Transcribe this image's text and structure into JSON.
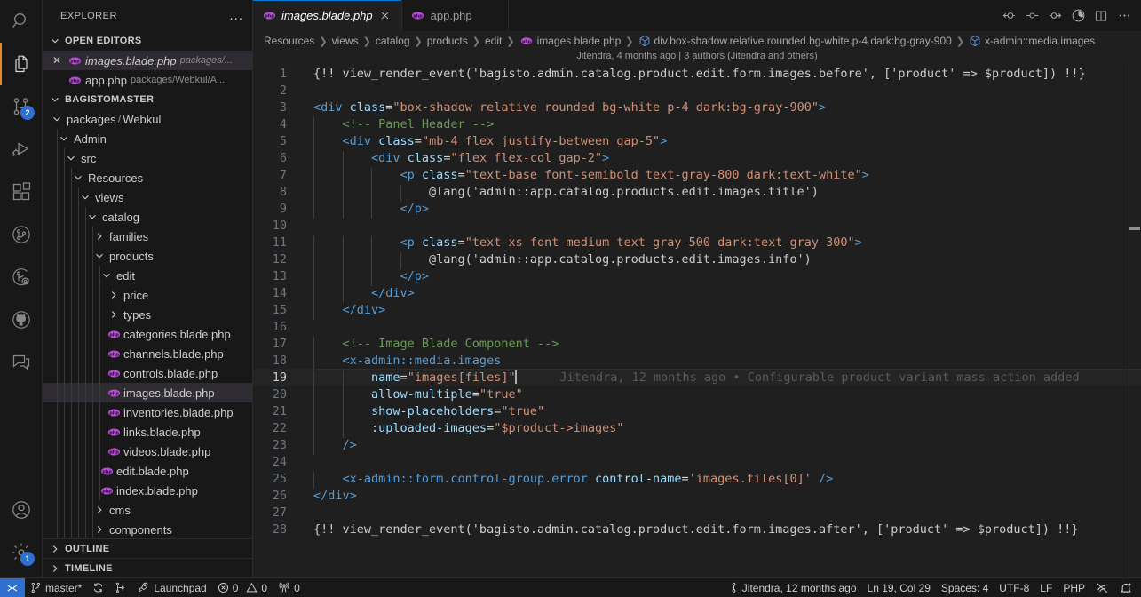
{
  "activity_bar": {
    "top_items": [
      {
        "name": "search-icon",
        "tooltip": "Search",
        "active": false,
        "badge": null
      },
      {
        "name": "explorer-icon",
        "tooltip": "Explorer",
        "active": true,
        "badge": null
      },
      {
        "name": "source-control-icon",
        "tooltip": "Source Control",
        "active": false,
        "badge": "2"
      },
      {
        "name": "run-and-debug-icon",
        "tooltip": "Run and Debug",
        "active": false,
        "badge": null
      },
      {
        "name": "extensions-icon",
        "tooltip": "Extensions",
        "active": false,
        "badge": null
      },
      {
        "name": "git-graph-icon",
        "tooltip": "Git Graph",
        "active": false,
        "badge": null
      },
      {
        "name": "git-lens-icon",
        "tooltip": "GitLens",
        "active": false,
        "badge": null
      },
      {
        "name": "github-icon",
        "tooltip": "GitHub",
        "active": false,
        "badge": null
      },
      {
        "name": "comments-icon",
        "tooltip": "Comments",
        "active": false,
        "badge": null
      }
    ],
    "bottom_items": [
      {
        "name": "account-icon",
        "tooltip": "Accounts",
        "badge": null
      },
      {
        "name": "settings-gear-icon",
        "tooltip": "Manage",
        "badge": "1"
      }
    ]
  },
  "sidebar": {
    "title": "EXPLORER",
    "more_actions_label": "...",
    "open_editors": {
      "label": "OPEN EDITORS",
      "expanded": true,
      "items": [
        {
          "name": "images.blade.php",
          "description": "packages/...",
          "selected": true,
          "dirty": false,
          "close_glyph": "✕",
          "italic": true
        },
        {
          "name": "app.php",
          "description": "packages/Webkul/A...",
          "selected": false,
          "dirty": false,
          "close_glyph": "✕",
          "italic": false
        }
      ]
    },
    "workspace": {
      "label": "BAGISTOMASTER",
      "expanded": true,
      "tree": [
        {
          "label": "packages",
          "label2": "Webkul",
          "kind": "folder",
          "depth": 1,
          "expanded": true,
          "selected": false
        },
        {
          "label": "Admin",
          "kind": "folder",
          "depth": 2,
          "expanded": true,
          "selected": false
        },
        {
          "label": "src",
          "kind": "folder",
          "depth": 3,
          "expanded": true,
          "selected": false
        },
        {
          "label": "Resources",
          "kind": "folder",
          "depth": 4,
          "expanded": true,
          "selected": false
        },
        {
          "label": "views",
          "kind": "folder",
          "depth": 5,
          "expanded": true,
          "selected": false
        },
        {
          "label": "catalog",
          "kind": "folder",
          "depth": 6,
          "expanded": true,
          "selected": false
        },
        {
          "label": "families",
          "kind": "folder",
          "depth": 7,
          "expanded": false,
          "selected": false
        },
        {
          "label": "products",
          "kind": "folder",
          "depth": 7,
          "expanded": true,
          "selected": false
        },
        {
          "label": "edit",
          "kind": "folder",
          "depth": 8,
          "expanded": true,
          "selected": false
        },
        {
          "label": "price",
          "kind": "folder",
          "depth": 9,
          "expanded": false,
          "selected": false
        },
        {
          "label": "types",
          "kind": "folder",
          "depth": 9,
          "expanded": false,
          "selected": false
        },
        {
          "label": "categories.blade.php",
          "kind": "php",
          "depth": 9,
          "expanded": false,
          "selected": false
        },
        {
          "label": "channels.blade.php",
          "kind": "php",
          "depth": 9,
          "expanded": false,
          "selected": false
        },
        {
          "label": "controls.blade.php",
          "kind": "php",
          "depth": 9,
          "expanded": false,
          "selected": false
        },
        {
          "label": "images.blade.php",
          "kind": "php",
          "depth": 9,
          "expanded": false,
          "selected": true
        },
        {
          "label": "inventories.blade.php",
          "kind": "php",
          "depth": 9,
          "expanded": false,
          "selected": false
        },
        {
          "label": "links.blade.php",
          "kind": "php",
          "depth": 9,
          "expanded": false,
          "selected": false
        },
        {
          "label": "videos.blade.php",
          "kind": "php",
          "depth": 9,
          "expanded": false,
          "selected": false
        },
        {
          "label": "edit.blade.php",
          "kind": "php",
          "depth": 8,
          "expanded": false,
          "selected": false
        },
        {
          "label": "index.blade.php",
          "kind": "php",
          "depth": 8,
          "expanded": false,
          "selected": false
        },
        {
          "label": "cms",
          "kind": "folder",
          "depth": 7,
          "expanded": false,
          "selected": false
        },
        {
          "label": "components",
          "kind": "folder",
          "depth": 7,
          "expanded": false,
          "selected": false
        }
      ]
    },
    "collapsed_sections": [
      {
        "label": "OUTLINE"
      },
      {
        "label": "TIMELINE"
      }
    ]
  },
  "editor_tabs": [
    {
      "label": "images.blade.php",
      "icon": "php-icon",
      "active": true,
      "has_close": true,
      "italic": true
    },
    {
      "label": "app.php",
      "icon": "php-icon",
      "active": false,
      "has_close": false,
      "italic": false
    }
  ],
  "tabbar_actions": [
    {
      "name": "go-back-commit-icon"
    },
    {
      "name": "commit-dot-icon"
    },
    {
      "name": "go-forward-commit-icon"
    },
    {
      "name": "toggle-blame-icon"
    },
    {
      "name": "split-editor-icon"
    },
    {
      "name": "more-actions-icon"
    }
  ],
  "breadcrumbs": [
    {
      "label": "Resources",
      "icon": null
    },
    {
      "label": "views",
      "icon": null
    },
    {
      "label": "catalog",
      "icon": null
    },
    {
      "label": "products",
      "icon": null
    },
    {
      "label": "edit",
      "icon": null
    },
    {
      "label": "images.blade.php",
      "icon": "php-icon"
    },
    {
      "label": "div.box-shadow.relative.rounded.bg-white.p-4.dark:bg-gray-900",
      "icon": "symbol-cube-icon"
    },
    {
      "label": "x-admin::media.images",
      "icon": "symbol-cube-icon"
    }
  ],
  "blame_header": "Jitendra, 4 months ago | 3 authors (Jitendra and others)",
  "editor": {
    "inline_blame_line": 19,
    "inline_blame_text": "Jitendra, 12 months ago • Configurable product variant mass action added",
    "active_line": 19,
    "lines": [
      {
        "n": 1,
        "tokens": [
          {
            "t": "{!! view_render_event('bagisto.admin.catalog.product.edit.form.images.before', ['product' => $product]) !!}",
            "c": "t-punct"
          }
        ]
      },
      {
        "n": 2,
        "tokens": []
      },
      {
        "n": 3,
        "tokens": [
          {
            "t": "<div ",
            "c": "t-tag"
          },
          {
            "t": "class",
            "c": "t-attr"
          },
          {
            "t": "=",
            "c": "t-op"
          },
          {
            "t": "\"box-shadow relative rounded bg-white p-4 dark:bg-gray-900\"",
            "c": "t-string"
          },
          {
            "t": ">",
            "c": "t-tag"
          }
        ]
      },
      {
        "n": 4,
        "tokens": [
          {
            "t": "    <!-- Panel Header -->",
            "c": "t-comment"
          }
        ]
      },
      {
        "n": 5,
        "tokens": [
          {
            "t": "    <div ",
            "c": "t-tag"
          },
          {
            "t": "class",
            "c": "t-attr"
          },
          {
            "t": "=",
            "c": "t-op"
          },
          {
            "t": "\"mb-4 flex justify-between gap-5\"",
            "c": "t-string"
          },
          {
            "t": ">",
            "c": "t-tag"
          }
        ]
      },
      {
        "n": 6,
        "tokens": [
          {
            "t": "        <div ",
            "c": "t-tag"
          },
          {
            "t": "class",
            "c": "t-attr"
          },
          {
            "t": "=",
            "c": "t-op"
          },
          {
            "t": "\"flex flex-col gap-2\"",
            "c": "t-string"
          },
          {
            "t": ">",
            "c": "t-tag"
          }
        ]
      },
      {
        "n": 7,
        "tokens": [
          {
            "t": "            <p ",
            "c": "t-tag"
          },
          {
            "t": "class",
            "c": "t-attr"
          },
          {
            "t": "=",
            "c": "t-op"
          },
          {
            "t": "\"text-base font-semibold text-gray-800 dark:text-white\"",
            "c": "t-string"
          },
          {
            "t": ">",
            "c": "t-tag"
          }
        ]
      },
      {
        "n": 8,
        "tokens": [
          {
            "t": "                @lang('admin::app.catalog.products.edit.images.title')",
            "c": "t-punct"
          }
        ]
      },
      {
        "n": 9,
        "tokens": [
          {
            "t": "            </p>",
            "c": "t-tag"
          }
        ]
      },
      {
        "n": 10,
        "tokens": []
      },
      {
        "n": 11,
        "tokens": [
          {
            "t": "            <p ",
            "c": "t-tag"
          },
          {
            "t": "class",
            "c": "t-attr"
          },
          {
            "t": "=",
            "c": "t-op"
          },
          {
            "t": "\"text-xs font-medium text-gray-500 dark:text-gray-300\"",
            "c": "t-string"
          },
          {
            "t": ">",
            "c": "t-tag"
          }
        ]
      },
      {
        "n": 12,
        "tokens": [
          {
            "t": "                @lang('admin::app.catalog.products.edit.images.info')",
            "c": "t-punct"
          }
        ]
      },
      {
        "n": 13,
        "tokens": [
          {
            "t": "            </p>",
            "c": "t-tag"
          }
        ]
      },
      {
        "n": 14,
        "tokens": [
          {
            "t": "        </div>",
            "c": "t-tag"
          }
        ]
      },
      {
        "n": 15,
        "tokens": [
          {
            "t": "    </div>",
            "c": "t-tag"
          }
        ]
      },
      {
        "n": 16,
        "tokens": []
      },
      {
        "n": 17,
        "tokens": [
          {
            "t": "    <!-- Image Blade Component -->",
            "c": "t-comment"
          }
        ]
      },
      {
        "n": 18,
        "tokens": [
          {
            "t": "    <x-admin::media.images",
            "c": "t-tag"
          }
        ]
      },
      {
        "n": 19,
        "tokens": [
          {
            "t": "        name",
            "c": "t-attr"
          },
          {
            "t": "=",
            "c": "t-op"
          },
          {
            "t": "\"images[files]\"",
            "c": "t-string"
          }
        ]
      },
      {
        "n": 20,
        "tokens": [
          {
            "t": "        allow-multiple",
            "c": "t-attr"
          },
          {
            "t": "=",
            "c": "t-op"
          },
          {
            "t": "\"true\"",
            "c": "t-string"
          }
        ]
      },
      {
        "n": 21,
        "tokens": [
          {
            "t": "        show-placeholders",
            "c": "t-attr"
          },
          {
            "t": "=",
            "c": "t-op"
          },
          {
            "t": "\"true\"",
            "c": "t-string"
          }
        ]
      },
      {
        "n": 22,
        "tokens": [
          {
            "t": "        :uploaded-images",
            "c": "t-attr"
          },
          {
            "t": "=",
            "c": "t-op"
          },
          {
            "t": "\"$product->images\"",
            "c": "t-string"
          }
        ]
      },
      {
        "n": 23,
        "tokens": [
          {
            "t": "    />",
            "c": "t-tag"
          }
        ]
      },
      {
        "n": 24,
        "tokens": []
      },
      {
        "n": 25,
        "tokens": [
          {
            "t": "    <x-admin::form.control-group.error ",
            "c": "t-tag"
          },
          {
            "t": "control-name",
            "c": "t-attr"
          },
          {
            "t": "=",
            "c": "t-op"
          },
          {
            "t": "'images.files[0]'",
            "c": "t-string"
          },
          {
            "t": " />",
            "c": "t-tag"
          }
        ]
      },
      {
        "n": 26,
        "tokens": [
          {
            "t": "</div>",
            "c": "t-tag"
          }
        ]
      },
      {
        "n": 27,
        "tokens": []
      },
      {
        "n": 28,
        "tokens": [
          {
            "t": "{!! view_render_event('bagisto.admin.catalog.product.edit.form.images.after', ['product' => $product]) !!}",
            "c": "t-punct"
          }
        ]
      }
    ]
  },
  "status_bar": {
    "remote_label": "",
    "left_items": [
      {
        "name": "branch-status",
        "icon": "source-control-branch-icon",
        "label": "master*"
      },
      {
        "name": "sync-status",
        "icon": "sync-icon",
        "label": ""
      },
      {
        "name": "git-graph-status",
        "icon": "git-graph-icon",
        "label": ""
      },
      {
        "name": "launchpad-status",
        "icon": "launchpad-icon",
        "label": "Launchpad"
      },
      {
        "name": "problems-status",
        "icon": "errors-warnings-icon",
        "label": "0  0"
      },
      {
        "name": "ports-status",
        "icon": "radio-tower-icon",
        "label": "0"
      }
    ],
    "errors_count": "0",
    "warnings_count": "0",
    "ports_count": "0",
    "right_items": [
      {
        "name": "blame-status",
        "icon": "gitlens-icon",
        "label": "Jitendra, 12 months ago"
      },
      {
        "name": "cursor-position",
        "icon": null,
        "label": "Ln 19, Col 29"
      },
      {
        "name": "indentation",
        "icon": null,
        "label": "Spaces: 4"
      },
      {
        "name": "encoding",
        "icon": null,
        "label": "UTF-8"
      },
      {
        "name": "eol",
        "icon": null,
        "label": "LF"
      },
      {
        "name": "language-mode",
        "icon": null,
        "label": "PHP"
      },
      {
        "name": "prettier-status",
        "icon": "prettier-icon",
        "label": ""
      },
      {
        "name": "notifications",
        "icon": "bell-dot-icon",
        "label": ""
      }
    ]
  },
  "colors": {
    "activity_bar_bg": "#181818",
    "sidebar_bg": "#181818",
    "editor_bg": "#1f1f1f",
    "accent_blue": "#2f6fd0",
    "active_tab_border": "#0078d4",
    "php_icon": "#b84fd6",
    "selection_bg": "#2f2b33",
    "string": "#ce9178",
    "tag": "#569cd6",
    "attribute": "#9cdcfe",
    "comment": "#6a9955"
  }
}
